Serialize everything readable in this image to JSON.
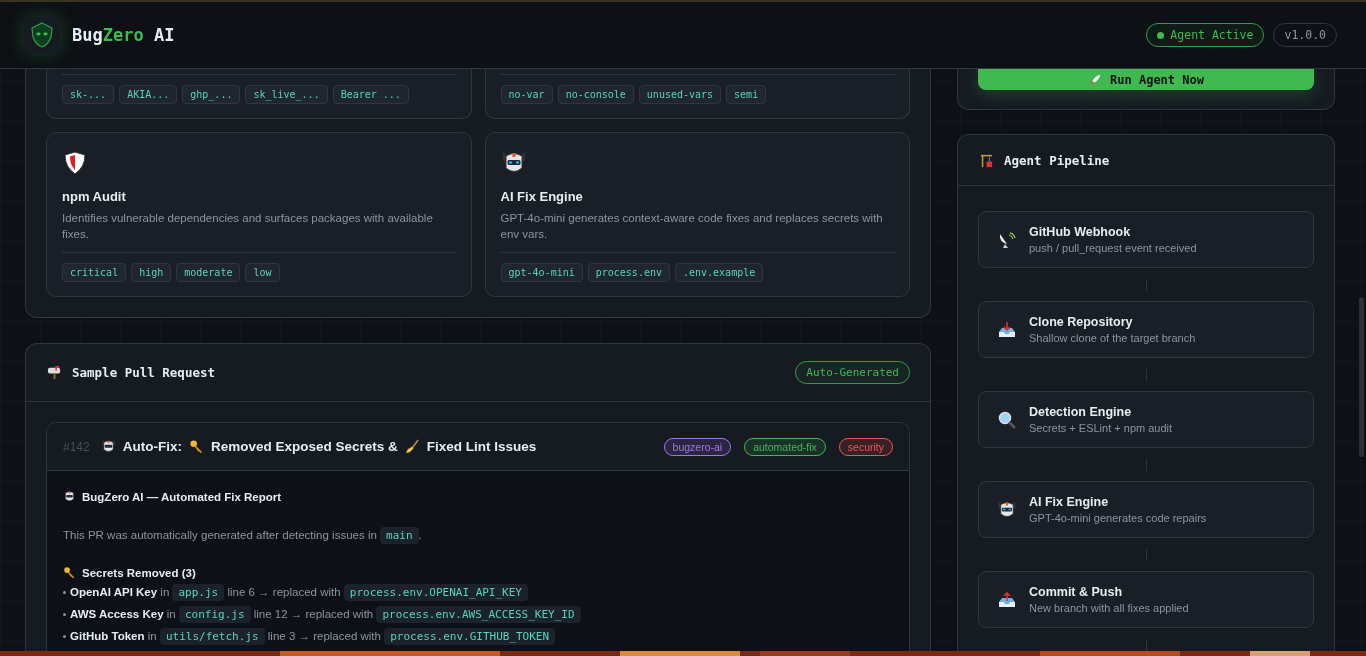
{
  "header": {
    "brand": [
      {
        "text": "Bug",
        "accent": false
      },
      {
        "text": "Zero",
        "accent": true
      },
      {
        "text": " AI",
        "accent": false
      }
    ],
    "status": {
      "label": "Agent Active",
      "active": true
    },
    "version": "v1.0.0"
  },
  "features": [
    {
      "kind": "partial",
      "tags": [
        "sk-...",
        "AKIA...",
        "ghp_...",
        "sk_live_...",
        "Bearer ..."
      ]
    },
    {
      "kind": "partial",
      "tags": [
        "no-var",
        "no-console",
        "unused-vars",
        "semi"
      ]
    },
    {
      "kind": "full",
      "title": "npm Audit",
      "description": "Identifies vulnerable dependencies and surfaces packages with available fixes.",
      "tags": [
        "critical",
        "high",
        "moderate",
        "low"
      ]
    },
    {
      "kind": "full",
      "title": "AI Fix Engine",
      "description": "GPT-4o-mini generates context-aware code fixes and replaces secrets with env vars.",
      "tags": [
        "gpt-4o-mini",
        "process.env",
        ".env.example"
      ]
    }
  ],
  "pull_request_panel": {
    "title": "Sample Pull Request",
    "badge": "Auto-Generated",
    "pr": {
      "number": "#142",
      "title": [
        "Auto-Fix:",
        "Removed Exposed Secrets &",
        "Fixed Lint Issues"
      ],
      "labels": [
        {
          "text": "bugzero-ai",
          "color": "#a371f7"
        },
        {
          "text": "automated-fix",
          "color": "#3fb950"
        },
        {
          "text": "security",
          "color": "#f85149"
        }
      ],
      "report_heading": "BugZero AI — Automated Fix Report",
      "intro": [
        {
          "kind": "text",
          "text": "This PR was automatically generated after detecting issues in"
        },
        {
          "kind": "code",
          "text": "main"
        },
        {
          "kind": "text",
          "text": "."
        }
      ],
      "secrets_heading": "Secrets Removed (3)",
      "secrets": [
        [
          {
            "kind": "bold",
            "text": "OpenAI API Key"
          },
          {
            "kind": "text",
            "text": "in"
          },
          {
            "kind": "code",
            "text": "app.js"
          },
          {
            "kind": "text",
            "text": "line 6 → replaced with"
          },
          {
            "kind": "code",
            "text": "process.env.OPENAI_API_KEY"
          }
        ],
        [
          {
            "kind": "bold",
            "text": "AWS Access Key"
          },
          {
            "kind": "text",
            "text": "in"
          },
          {
            "kind": "code",
            "text": "config.js"
          },
          {
            "kind": "text",
            "text": "line 12 → replaced with"
          },
          {
            "kind": "code",
            "text": "process.env.AWS_ACCESS_KEY_ID"
          }
        ],
        [
          {
            "kind": "bold",
            "text": "GitHub Token"
          },
          {
            "kind": "text",
            "text": "in"
          },
          {
            "kind": "code",
            "text": "utils/fetch.js"
          },
          {
            "kind": "text",
            "text": "line 3 → replaced with"
          },
          {
            "kind": "code",
            "text": "process.env.GITHUB_TOKEN"
          }
        ]
      ]
    }
  },
  "run_button": "Run Agent Now",
  "pipeline": {
    "title": "Agent Pipeline",
    "steps": [
      {
        "title": "GitHub Webhook",
        "subtitle": "push / pull_request event received"
      },
      {
        "title": "Clone Repository",
        "subtitle": "Shallow clone of the target branch"
      },
      {
        "title": "Detection Engine",
        "subtitle": "Secrets + ESLint + npm audit"
      },
      {
        "title": "AI Fix Engine",
        "subtitle": "GPT-4o-mini generates code repairs"
      },
      {
        "title": "Commit & Push",
        "subtitle": "New branch with all fixes applied"
      }
    ]
  }
}
